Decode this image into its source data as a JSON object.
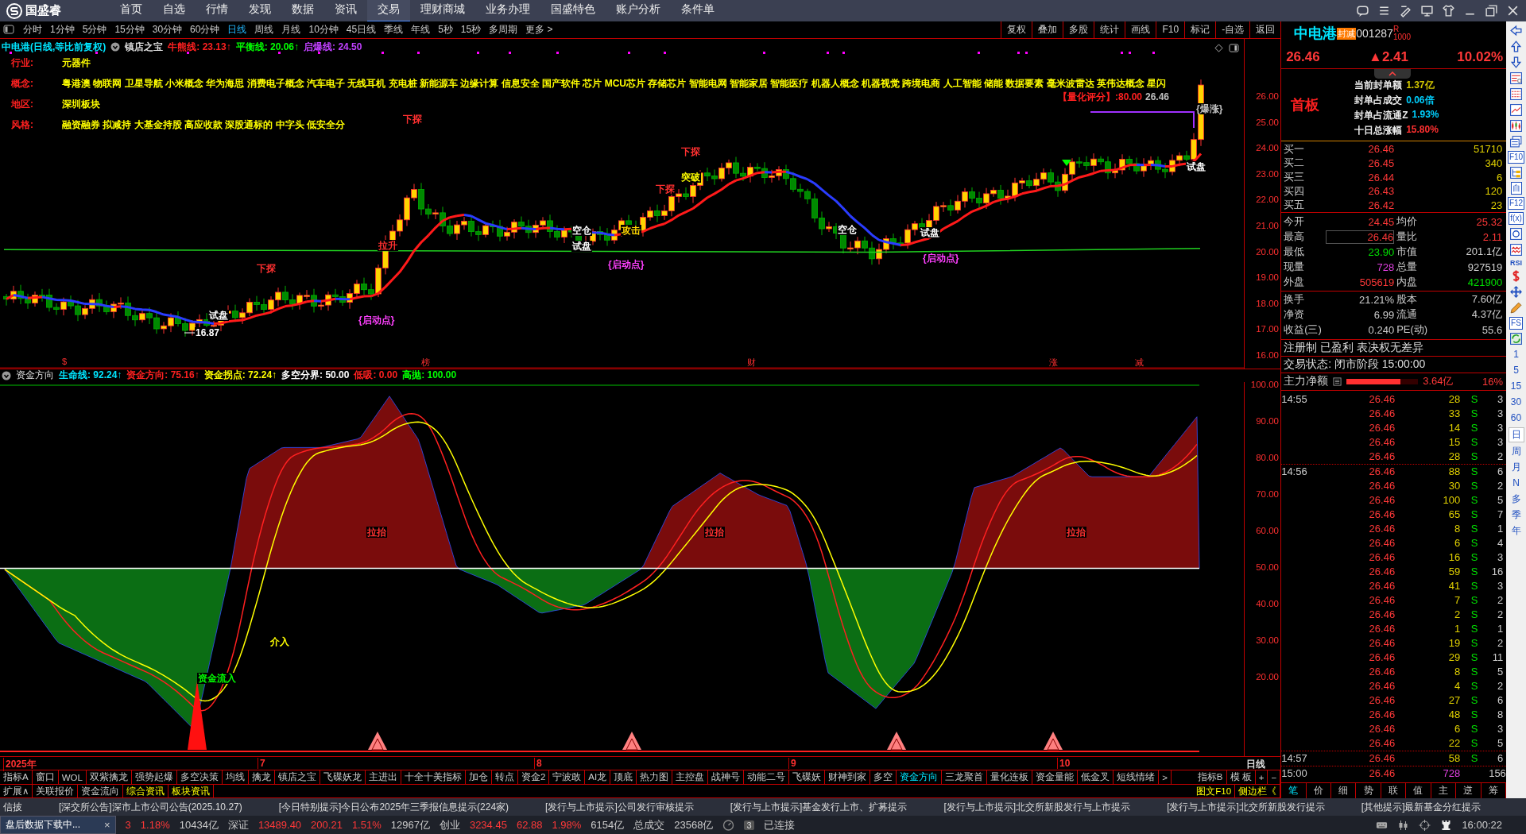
{
  "menu": {
    "logo": "国盛睿",
    "items": [
      {
        "label": "首页",
        "selected": false
      },
      {
        "label": "自选",
        "selected": false
      },
      {
        "label": "行情",
        "selected": false
      },
      {
        "label": "发现",
        "selected": false
      },
      {
        "label": "数据",
        "selected": false
      },
      {
        "label": "资讯",
        "selected": false
      },
      {
        "label": "交易",
        "selected": true
      },
      {
        "label": "理财商城",
        "selected": false
      },
      {
        "label": "业务办理",
        "selected": false
      },
      {
        "label": "国盛特色",
        "selected": false
      },
      {
        "label": "账户分析",
        "selected": false
      },
      {
        "label": "条件单",
        "selected": false
      }
    ]
  },
  "periods": [
    {
      "label": "分时",
      "selected": false
    },
    {
      "label": "1分钟",
      "selected": false
    },
    {
      "label": "5分钟",
      "selected": false
    },
    {
      "label": "15分钟",
      "selected": false
    },
    {
      "label": "30分钟",
      "selected": false
    },
    {
      "label": "60分钟",
      "selected": false
    },
    {
      "label": "日线",
      "selected": true
    },
    {
      "label": "周线",
      "selected": false
    },
    {
      "label": "月线",
      "selected": false
    },
    {
      "label": "10分钟",
      "selected": false
    },
    {
      "label": "45日线",
      "selected": false
    },
    {
      "label": "季线",
      "selected": false
    },
    {
      "label": "年线",
      "selected": false
    },
    {
      "label": "5秒",
      "selected": false
    },
    {
      "label": "15秒",
      "selected": false
    },
    {
      "label": "多周期",
      "selected": false
    },
    {
      "label": "更多 >",
      "selected": false
    }
  ],
  "chart_tools": [
    "复权",
    "叠加",
    "多股",
    "统计",
    "画线",
    "F10",
    "标记",
    "-自选",
    "返回"
  ],
  "price_chart": {
    "title": "中电港(日线,等比前复权)",
    "indicator": "镇店之宝",
    "lines": [
      {
        "label": "牛熊线: 23.13↑",
        "color": "#ff2020"
      },
      {
        "label": "平衡线: 20.06↑",
        "color": "#00ff00"
      },
      {
        "label": "启爆线: 24.50",
        "color": "#c040ff"
      }
    ],
    "info": [
      {
        "key": "行业:",
        "value": "元器件"
      },
      {
        "key": "概念:",
        "value": "粤港澳 物联网 卫星导航 小米概念 华为海思 消费电子概念 汽车电子 无线耳机 充电桩 新能源车 边缘计算 信息安全 国产软件 芯片 MCU芯片 存储芯片 智能电网 智能家居 智能医疗 机器人概念 机器视觉 跨境电商 人工智能 储能 数据要素 毫米波雷达 英伟达概念 星闪"
      },
      {
        "key": "地区:",
        "value": "深圳板块"
      },
      {
        "key": "风格:",
        "value": "融资融券 拟减持 大基金持股 高应收款 深股通标的 中字头 低安全分"
      }
    ],
    "signals": [
      {
        "text": "下探",
        "kind": "fall"
      },
      {
        "text": "下探",
        "kind": "fall"
      },
      {
        "text": "拉升",
        "kind": "rise"
      },
      {
        "text": "试盘",
        "kind": "test"
      },
      {
        "text": "16.87",
        "kind": "low"
      },
      {
        "text": "{启动点}",
        "kind": "start"
      },
      {
        "text": "空仓",
        "kind": "cash"
      },
      {
        "text": "试盘",
        "kind": "test"
      },
      {
        "text": "攻击",
        "kind": "attack"
      },
      {
        "text": "下探",
        "kind": "fall"
      },
      {
        "text": "突破",
        "kind": "break"
      },
      {
        "text": "下探",
        "kind": "fall"
      },
      {
        "text": "{启动点}",
        "kind": "start"
      },
      {
        "text": "空仓",
        "kind": "cash"
      },
      {
        "text": "试盘",
        "kind": "test"
      },
      {
        "text": "{启动点}",
        "kind": "start"
      },
      {
        "text": "试盘",
        "kind": "test"
      },
      {
        "text": "{爆涨}",
        "kind": "boom"
      },
      {
        "text": "26.46",
        "kind": "price"
      },
      {
        "text": "【量化评分】:80.00",
        "kind": "score"
      }
    ],
    "markers": [
      "$",
      "榜",
      "财",
      "涨",
      "减"
    ],
    "yticks": [
      "26.00",
      "25.00",
      "24.00",
      "23.00",
      "22.00",
      "21.00",
      "20.00",
      "19.00",
      "18.00",
      "17.00",
      "16.00"
    ]
  },
  "fund_chart": {
    "title": "资金方向",
    "lines": [
      {
        "label": "生命线: 92.24↑",
        "color": "#00e5ff"
      },
      {
        "label": "资金方向: 75.16↑",
        "color": "#ff2020"
      },
      {
        "label": "资金拐点: 72.24↑",
        "color": "#ffff00"
      },
      {
        "label": "多空分界: 50.00",
        "color": "#ffffff"
      },
      {
        "label": "低吸: 0.00",
        "color": "#ff2020"
      },
      {
        "label": "高抛: 100.00",
        "color": "#00ff00"
      }
    ],
    "signals": [
      {
        "text": "资金流入",
        "kind": "inflow"
      },
      {
        "text": "介入",
        "kind": "enter"
      },
      {
        "text": "拉抬",
        "kind": "lift"
      },
      {
        "text": "拉抬",
        "kind": "lift"
      },
      {
        "text": "拉抬",
        "kind": "lift"
      }
    ],
    "yticks": [
      "100.00",
      "90.00",
      "80.00",
      "70.00",
      "60.00",
      "50.00",
      "40.00",
      "30.00",
      "20.00"
    ]
  },
  "x_axis": {
    "labels": [
      "2025年",
      "7",
      "8",
      "9",
      "10"
    ],
    "period": "日线"
  },
  "indicator_tabs": [
    {
      "label": "指标A",
      "selected": false
    },
    {
      "label": "窗口",
      "selected": false
    },
    {
      "label": "WOL",
      "selected": false
    },
    {
      "label": "双紫擒龙",
      "selected": false
    },
    {
      "label": "强势起爆",
      "selected": false
    },
    {
      "label": "多空决策",
      "selected": false
    },
    {
      "label": "均线",
      "selected": false
    },
    {
      "label": "擒龙",
      "selected": false
    },
    {
      "label": "镇店之宝",
      "selected": false
    },
    {
      "label": "飞碟妖龙",
      "selected": false
    },
    {
      "label": "主进出",
      "selected": false
    },
    {
      "label": "十全十美指标",
      "selected": false
    },
    {
      "label": "加仓",
      "selected": false
    },
    {
      "label": "转点",
      "selected": false
    },
    {
      "label": "资金2",
      "selected": false
    },
    {
      "label": "宁波敢",
      "selected": false
    },
    {
      "label": "AI龙",
      "selected": false
    },
    {
      "label": "顶底",
      "selected": false
    },
    {
      "label": "热力图",
      "selected": false
    },
    {
      "label": "主控盘",
      "selected": false
    },
    {
      "label": "战神号",
      "selected": false
    },
    {
      "label": "动能二号",
      "selected": false
    },
    {
      "label": "飞碟妖",
      "selected": false
    },
    {
      "label": "财神到家",
      "selected": false
    },
    {
      "label": "多空",
      "selected": false
    },
    {
      "label": "资金方向",
      "selected": true
    },
    {
      "label": "三龙聚首",
      "selected": false
    },
    {
      "label": "量化连板",
      "selected": false
    },
    {
      "label": "资金量能",
      "selected": false
    },
    {
      "label": "低金叉",
      "selected": false
    },
    {
      "label": "短线情绪",
      "selected": false
    },
    {
      "label": ">",
      "selected": false
    }
  ],
  "indicator_tools": [
    "指标B",
    "模 板",
    "+",
    "−"
  ],
  "extra_tabs": [
    {
      "label": "扩展∧",
      "kind": "tool"
    },
    {
      "label": "关联报价",
      "kind": "tool"
    },
    {
      "label": "资金流向",
      "kind": "tool"
    },
    {
      "label": "综合资讯",
      "kind": "info"
    },
    {
      "label": "板块资讯",
      "kind": "info"
    }
  ],
  "extra_links": [
    "图文F10",
    "侧边栏《"
  ],
  "quote": {
    "name": "中电港",
    "tag": "封减",
    "code": "001287",
    "mark": "R",
    "lot": "1000",
    "price": "26.46",
    "change": "▲2.41",
    "percent": "10.02%",
    "board": "首板",
    "seal": [
      {
        "label": "当前封单额",
        "value": "1.37亿",
        "color": "#d4c800"
      },
      {
        "label": "封单占成交",
        "value": "0.06倍",
        "color": "#00d0ff"
      },
      {
        "label": "封单占流通Z",
        "value": "1.93%",
        "color": "#00d0ff"
      },
      {
        "label": "十日总涨幅",
        "value": "15.80%",
        "color": "#ff3030"
      }
    ],
    "bids": [
      {
        "label": "买一",
        "price": "26.46",
        "volume": "51710"
      },
      {
        "label": "买二",
        "price": "26.45",
        "volume": "340"
      },
      {
        "label": "买三",
        "price": "26.44",
        "volume": "6"
      },
      {
        "label": "买四",
        "price": "26.43",
        "volume": "120"
      },
      {
        "label": "买五",
        "price": "26.42",
        "volume": "23"
      }
    ],
    "stats": [
      {
        "label": "今开",
        "value": "24.45",
        "color": "#ff3838"
      },
      {
        "label": "均价",
        "value": "25.32",
        "color": "#ff3838"
      },
      {
        "label": "最高",
        "value": "26.46",
        "color": "#ff3838",
        "boxed": true
      },
      {
        "label": "量比",
        "value": "2.11",
        "color": "#ff3838"
      },
      {
        "label": "最低",
        "value": "23.90",
        "color": "#00e000"
      },
      {
        "label": "市值",
        "value": "201.1亿",
        "color": "#d0d0d0"
      },
      {
        "label": "现量",
        "value": "728",
        "color": "#e040e0"
      },
      {
        "label": "总量",
        "value": "927519",
        "color": "#d0d0d0"
      },
      {
        "label": "外盘",
        "value": "505619",
        "color": "#ff3838"
      },
      {
        "label": "内盘",
        "value": "421900",
        "color": "#00e000"
      }
    ],
    "stats2": [
      {
        "label": "换手",
        "value": "21.21%",
        "label2": "股本",
        "value2": "7.60亿"
      },
      {
        "label": "净资",
        "value": "6.99",
        "label2": "流通",
        "value2": "4.37亿"
      },
      {
        "label": "收益(三)",
        "value": "0.240",
        "label2": "PE(动)",
        "value2": "55.6"
      }
    ],
    "notice": "注册制 已盈利 表决权无差异",
    "status": "交易状态: 闭市阶段 15:00:00",
    "main_flow": {
      "label": "主力净额",
      "level": 0.75,
      "value": "3.64亿",
      "percent": "16%"
    }
  },
  "ticks": [
    {
      "time": "14:55",
      "price": "26.46",
      "volume": "28",
      "side": "S",
      "count": "3"
    },
    {
      "price": "26.46",
      "volume": "33",
      "side": "S",
      "count": "3"
    },
    {
      "price": "26.46",
      "volume": "14",
      "side": "S",
      "count": "3"
    },
    {
      "price": "26.46",
      "volume": "15",
      "side": "S",
      "count": "3"
    },
    {
      "price": "26.46",
      "volume": "28",
      "side": "S",
      "count": "2"
    },
    {
      "time": "14:56",
      "price": "26.46",
      "volume": "88",
      "side": "S",
      "count": "6"
    },
    {
      "price": "26.46",
      "volume": "30",
      "side": "S",
      "count": "2"
    },
    {
      "price": "26.46",
      "volume": "100",
      "side": "S",
      "count": "5"
    },
    {
      "price": "26.46",
      "volume": "65",
      "side": "S",
      "count": "7"
    },
    {
      "price": "26.46",
      "volume": "8",
      "side": "S",
      "count": "1"
    },
    {
      "price": "26.46",
      "volume": "6",
      "side": "S",
      "count": "4"
    },
    {
      "price": "26.46",
      "volume": "16",
      "side": "S",
      "count": "3"
    },
    {
      "price": "26.46",
      "volume": "59",
      "side": "S",
      "count": "16"
    },
    {
      "price": "26.46",
      "volume": "41",
      "side": "S",
      "count": "3"
    },
    {
      "price": "26.46",
      "volume": "7",
      "side": "S",
      "count": "2"
    },
    {
      "price": "26.46",
      "volume": "2",
      "side": "S",
      "count": "2"
    },
    {
      "price": "26.46",
      "volume": "1",
      "side": "S",
      "count": "1"
    },
    {
      "price": "26.46",
      "volume": "19",
      "side": "S",
      "count": "2"
    },
    {
      "price": "26.46",
      "volume": "29",
      "side": "S",
      "count": "11"
    },
    {
      "price": "26.46",
      "volume": "8",
      "side": "S",
      "count": "5"
    },
    {
      "price": "26.46",
      "volume": "4",
      "side": "S",
      "count": "2"
    },
    {
      "price": "26.46",
      "volume": "27",
      "side": "S",
      "count": "6"
    },
    {
      "price": "26.46",
      "volume": "48",
      "side": "S",
      "count": "8"
    },
    {
      "price": "26.46",
      "volume": "6",
      "side": "S",
      "count": "3"
    },
    {
      "price": "26.46",
      "volume": "22",
      "side": "S",
      "count": "5"
    },
    {
      "time": "14:57",
      "price": "26.46",
      "volume": "58",
      "side": "S",
      "count": "6"
    },
    {
      "time": "15:00",
      "price": "26.46",
      "volume": "728",
      "count": "156",
      "kind": "close"
    }
  ],
  "panel_tabs": [
    {
      "label": "笔",
      "selected": true
    },
    {
      "label": "价",
      "selected": false
    },
    {
      "label": "细",
      "selected": false
    },
    {
      "label": "势",
      "selected": false
    },
    {
      "label": "联",
      "selected": false
    },
    {
      "label": "值",
      "selected": false
    },
    {
      "label": "主",
      "selected": false
    },
    {
      "label": "逆",
      "selected": false
    },
    {
      "label": "筹",
      "selected": false
    }
  ],
  "side_strip": [
    {
      "kind": "arrow-left"
    },
    {
      "kind": "arrow-up"
    },
    {
      "kind": "arrow-down"
    },
    {
      "kind": "report"
    },
    {
      "kind": "grid"
    },
    {
      "kind": "line"
    },
    {
      "kind": "candles"
    },
    {
      "kind": "window"
    },
    {
      "kind": "text",
      "label": "F10"
    },
    {
      "kind": "tree"
    },
    {
      "kind": "text",
      "label": "自"
    },
    {
      "kind": "text",
      "label": "F12"
    },
    {
      "kind": "text",
      "label": "f(x)"
    },
    {
      "kind": "circle"
    },
    {
      "kind": "wave"
    },
    {
      "kind": "plain",
      "label": "RSI"
    },
    {
      "kind": "dollar"
    },
    {
      "kind": "move"
    },
    {
      "kind": "pencil"
    },
    {
      "kind": "text",
      "label": "FS"
    },
    {
      "kind": "refresh"
    }
  ],
  "side_periods": [
    {
      "label": "1",
      "selected": false
    },
    {
      "label": "5",
      "selected": false
    },
    {
      "label": "15",
      "selected": false
    },
    {
      "label": "30",
      "selected": false
    },
    {
      "label": "60",
      "selected": false
    },
    {
      "label": "日",
      "selected": true
    },
    {
      "label": "周",
      "selected": false
    },
    {
      "label": "月",
      "selected": false
    },
    {
      "label": "N",
      "selected": false
    },
    {
      "label": "多",
      "selected": false
    },
    {
      "label": "季",
      "selected": false
    },
    {
      "label": "年",
      "selected": false
    }
  ],
  "news": [
    "信披",
    "[深交所公告]深市上市公司公告(2025.10.27)",
    "[今日特别提示]今日公布2025年三季报信息提示(224家)",
    "[发行与上市提示]公司发行审核提示",
    "[发行与上市提示]基金发行上市、扩募提示",
    "[发行与上市提示]北交所新股发行与上市提示",
    "[发行与上市提示]北交所新股发行提示",
    "[其他提示]最新基金分红提示"
  ],
  "status_bar": {
    "popup": "盘后数据下载中...",
    "popup_close": "×",
    "items": [
      {
        "text": "3",
        "kind": "up"
      },
      {
        "text": "1.18%",
        "kind": "up"
      },
      {
        "text": "10434亿",
        "kind": "plain"
      },
      {
        "text": "深证",
        "kind": "plain"
      },
      {
        "text": "13489.40",
        "kind": "up"
      },
      {
        "text": "200.21",
        "kind": "up"
      },
      {
        "text": "1.51%",
        "kind": "up"
      },
      {
        "text": "12967亿",
        "kind": "plain"
      },
      {
        "text": "创业",
        "kind": "plain"
      },
      {
        "text": "3234.45",
        "kind": "up"
      },
      {
        "text": "62.88",
        "kind": "up"
      },
      {
        "text": "1.98%",
        "kind": "up"
      },
      {
        "text": "6154亿",
        "kind": "plain"
      },
      {
        "text": "总成交",
        "kind": "plain"
      },
      {
        "text": "23568亿",
        "kind": "plain"
      }
    ],
    "badge": "3",
    "connection": "已连接",
    "time": "16:00:22"
  }
}
